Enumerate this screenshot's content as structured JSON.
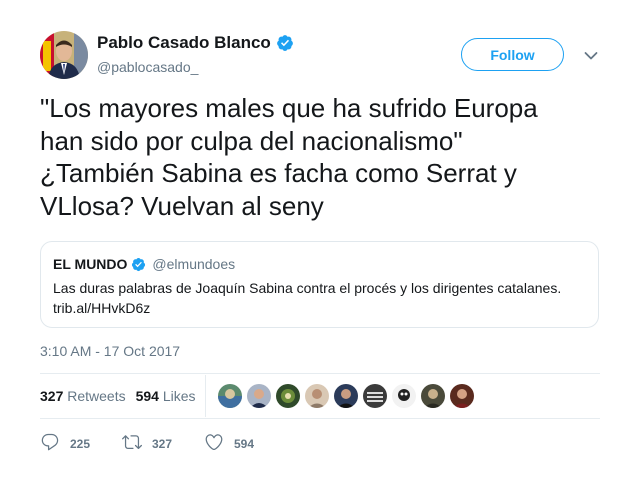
{
  "author": {
    "name": "Pablo Casado Blanco",
    "handle": "@pablocasado_"
  },
  "follow_label": "Follow",
  "tweet_text": "\"Los mayores males que ha sufrido Europa\nhan sido por culpa del nacionalismo\"\n¿También Sabina es facha como Serrat y\nVLlosa? Vuelvan al seny",
  "quoted": {
    "name": "EL MUNDO",
    "handle": "@elmundoes",
    "text": "Las duras palabras de Joaquín Sabina contra el procés y los dirigentes catalanes.",
    "link": "trib.al/HHvkD6z"
  },
  "timestamp": "3:10 AM - 17 Oct 2017",
  "stats": {
    "retweets_count": "327",
    "retweets_label": "Retweets",
    "likes_count": "594",
    "likes_label": "Likes"
  },
  "actions": {
    "reply_count": "225",
    "retweet_count": "327",
    "like_count": "594"
  },
  "colors": {
    "accent": "#1da1f2",
    "verified": "#1da1f2",
    "text": "#14171a",
    "secondary": "#657786"
  },
  "icons": [
    "verified-badge-icon",
    "chevron-down-icon",
    "reply-icon",
    "retweet-icon",
    "heart-icon"
  ]
}
